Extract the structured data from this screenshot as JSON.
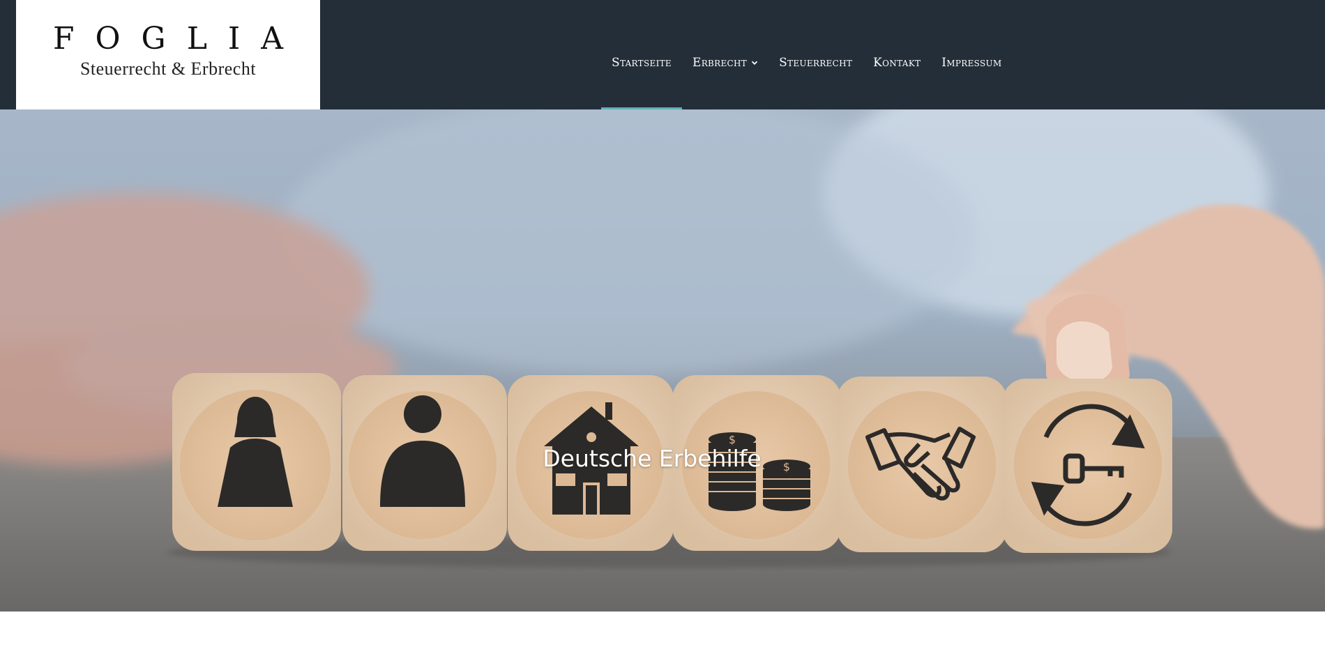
{
  "logo": {
    "title": "FOGLIA",
    "subtitle": "Steuerrecht & Erbrecht"
  },
  "nav": {
    "items": [
      {
        "label": "Startseite",
        "active": true
      },
      {
        "label": "Erbrecht",
        "has_dropdown": true
      },
      {
        "label": "Steuerrecht"
      },
      {
        "label": "Kontakt"
      },
      {
        "label": "Impressum"
      }
    ]
  },
  "hero": {
    "title": "Deutsche Erbehilfe",
    "dice_icons": [
      "woman-icon",
      "man-icon",
      "house-icon",
      "coins-icon",
      "handshake-icon",
      "key-exchange-icon"
    ]
  },
  "colors": {
    "header_bg": "#242e38",
    "active_underline": "#5fb3b3",
    "nav_text": "#ffffff"
  }
}
